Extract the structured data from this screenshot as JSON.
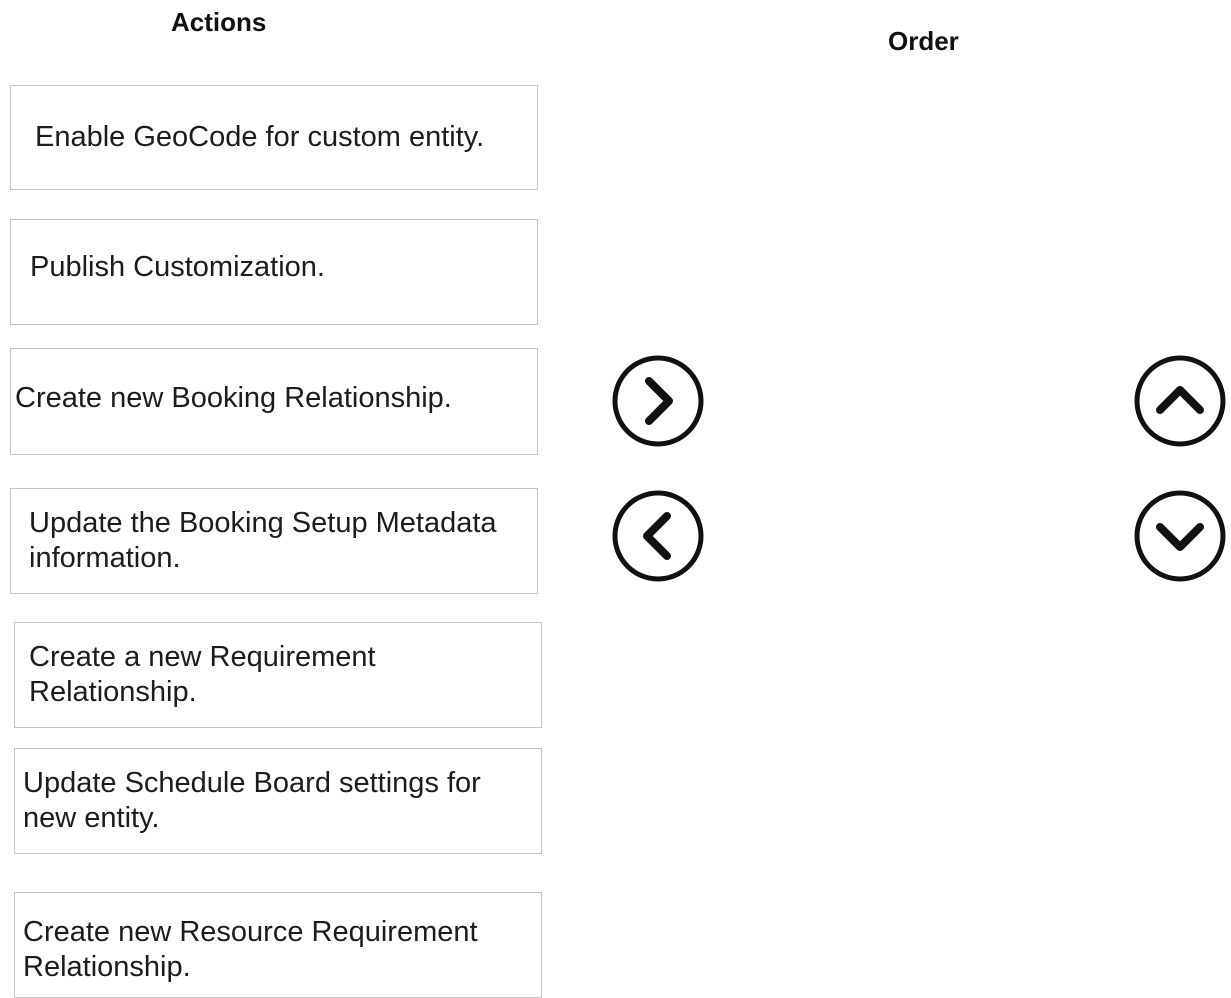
{
  "headings": {
    "actions": "Actions",
    "order": "Order"
  },
  "actions": [
    {
      "label": "Enable GeoCode for custom entity."
    },
    {
      "label": "Publish Customization."
    },
    {
      "label": "Create new Booking Relationship."
    },
    {
      "label": "Update the Booking Setup Metadata information."
    },
    {
      "label": "Create a new Requirement Relationship."
    },
    {
      "label": "Update Schedule Board settings for new entity."
    },
    {
      "label": "Create new Resource Requirement Relationship."
    }
  ],
  "order": [],
  "controls": {
    "move_right": {
      "icon": "chevron-right-circle-icon"
    },
    "move_left": {
      "icon": "chevron-left-circle-icon"
    },
    "move_up": {
      "icon": "chevron-up-circle-icon"
    },
    "move_down": {
      "icon": "chevron-down-circle-icon"
    }
  }
}
